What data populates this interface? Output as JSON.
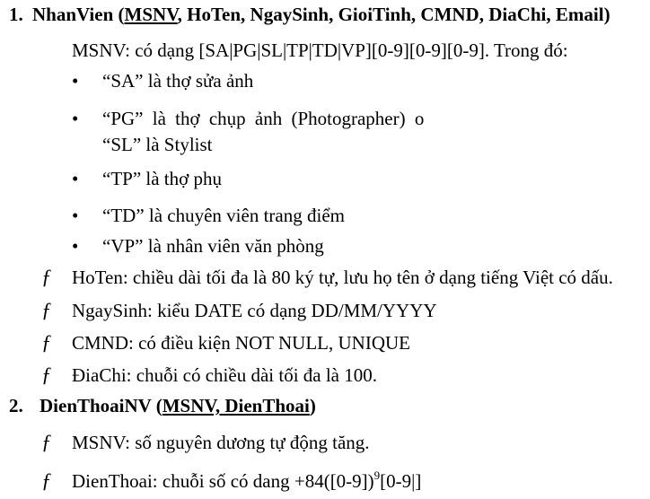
{
  "section1": {
    "number": "1.",
    "title": "NhanVien",
    "open_paren": " (",
    "keys": "MSNV",
    "rest": ", HoTen, NgaySinh, GioiTinh, CMND, DiaChi, Email)",
    "msnv_line": "MSNV: có dạng [SA|PG|SL|TP|TD|VP][0-9][0-9][0-9]. Trong đó:",
    "bullets": [
      "“SA” là thợ sửa ảnh",
      "“PG” là thợ chụp ảnh (Photographer) o",
      "“SL” là Stylist",
      "“TP” là thợ phụ",
      "“TD” là chuyên viên trang điểm",
      "“VP” là nhân viên văn phòng"
    ],
    "constraints": [
      "HoTen: chiều dài tối đa là 80 ký tự, lưu họ tên ở dạng tiếng Việt có dấu.",
      "NgaySinh: kiểu DATE có dạng DD/MM/YYYY",
      "CMND: có điều kiện NOT NULL, UNIQUE",
      "ĐiaChi: chuỗi có chiều dài tối đa là 100."
    ]
  },
  "section2": {
    "number": "2.",
    "title": "DienThoaiNV",
    "open_paren": " (",
    "keys": "MSNV, DienThoai",
    "close_paren": ")",
    "constraints": [
      "MSNV: số nguyên dương tự động tăng."
    ],
    "phone_prefix": "DienThoai: chuỗi số có dang +84([0-9])",
    "phone_sup": "9",
    "phone_suffix": "[0-9|]"
  },
  "symbols": {
    "bullet": "•",
    "f": "ƒ"
  }
}
